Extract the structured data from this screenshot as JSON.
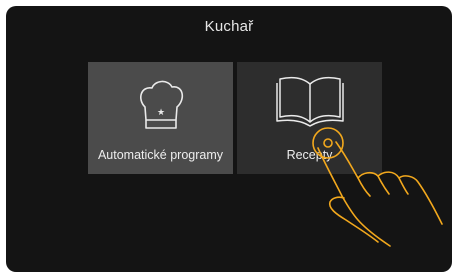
{
  "screen": {
    "title": "Kuchař",
    "tiles": [
      {
        "label": "Automatické programy",
        "icon": "chef-hat-icon",
        "selected": false
      },
      {
        "label": "Recepty",
        "icon": "open-book-icon",
        "selected": true
      }
    ]
  },
  "overlay": {
    "icon": "tap-hand-gesture-icon"
  },
  "colors": {
    "background": "#141414",
    "tile_highlight": "#4b4b4b",
    "tile_normal": "#2d2d2d",
    "gesture": "#f2a81d",
    "text": "#e6e6e6"
  }
}
